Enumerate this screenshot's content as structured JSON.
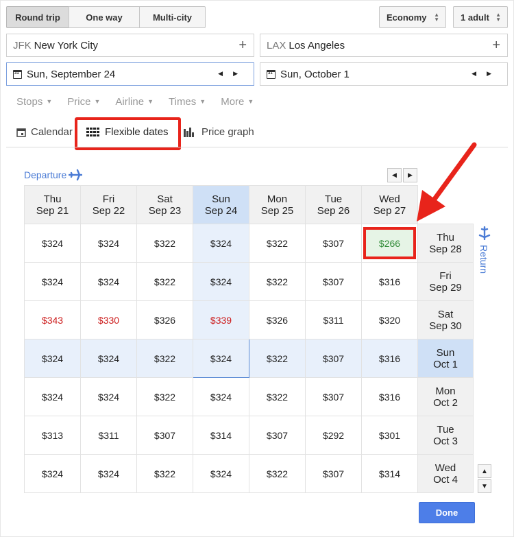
{
  "trip_types": [
    "Round trip",
    "One way",
    "Multi-city"
  ],
  "cabin": {
    "selected": "Economy"
  },
  "passengers": {
    "selected": "1 adult"
  },
  "origin": {
    "code": "JFK",
    "name": "New York City"
  },
  "destination": {
    "code": "LAX",
    "name": "Los Angeles"
  },
  "depart_date": "Sun, September 24",
  "return_date": "Sun, October 1",
  "filters": [
    "Stops",
    "Price",
    "Airline",
    "Times",
    "More"
  ],
  "view_tabs": {
    "calendar": "Calendar",
    "flexible": "Flexible dates",
    "graph": "Price graph"
  },
  "grid": {
    "departure_label": "Departure",
    "return_label": "Return",
    "departure_days": [
      {
        "dow": "Thu",
        "date": "Sep 21"
      },
      {
        "dow": "Fri",
        "date": "Sep 22"
      },
      {
        "dow": "Sat",
        "date": "Sep 23"
      },
      {
        "dow": "Sun",
        "date": "Sep 24"
      },
      {
        "dow": "Mon",
        "date": "Sep 25"
      },
      {
        "dow": "Tue",
        "date": "Sep 26"
      },
      {
        "dow": "Wed",
        "date": "Sep 27"
      }
    ],
    "return_days": [
      {
        "dow": "Thu",
        "date": "Sep 28"
      },
      {
        "dow": "Fri",
        "date": "Sep 29"
      },
      {
        "dow": "Sat",
        "date": "Sep 30"
      },
      {
        "dow": "Sun",
        "date": "Oct 1"
      },
      {
        "dow": "Mon",
        "date": "Oct 2"
      },
      {
        "dow": "Tue",
        "date": "Oct 3"
      },
      {
        "dow": "Wed",
        "date": "Oct 4"
      }
    ],
    "prices": [
      [
        "$324",
        "$324",
        "$322",
        "$324",
        "$322",
        "$307",
        "$266"
      ],
      [
        "$324",
        "$324",
        "$322",
        "$324",
        "$322",
        "$307",
        "$316"
      ],
      [
        "$343",
        "$330",
        "$326",
        "$339",
        "$326",
        "$311",
        "$320"
      ],
      [
        "$324",
        "$324",
        "$322",
        "$324",
        "$322",
        "$307",
        "$316"
      ],
      [
        "$324",
        "$324",
        "$322",
        "$324",
        "$322",
        "$307",
        "$316"
      ],
      [
        "$313",
        "$311",
        "$307",
        "$314",
        "$307",
        "$292",
        "$301"
      ],
      [
        "$324",
        "$324",
        "$322",
        "$324",
        "$322",
        "$307",
        "$314"
      ]
    ],
    "price_colors": {
      "high": "#cc1b1b",
      "low": "#2f8a35"
    }
  },
  "done_label": "Done",
  "colors": {
    "accent": "#4d7ee8",
    "highlight": "#e8241b"
  }
}
